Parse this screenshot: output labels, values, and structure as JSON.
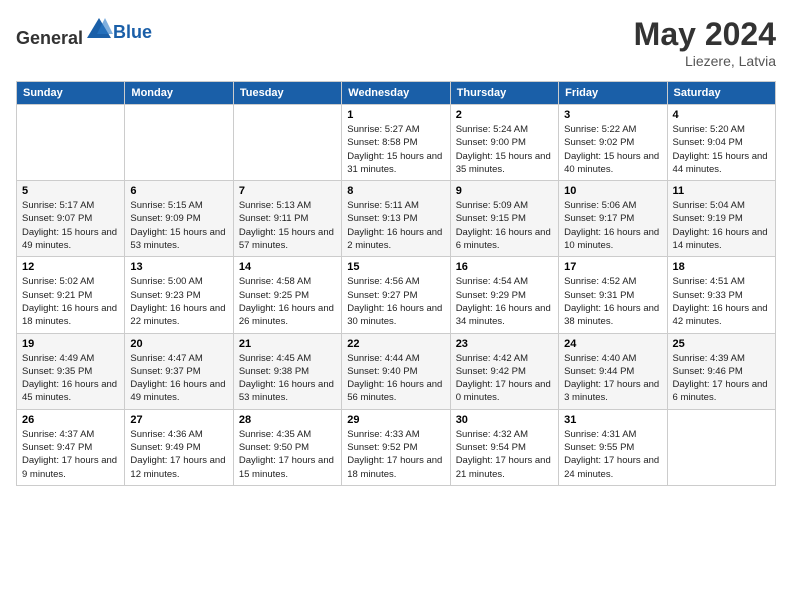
{
  "header": {
    "logo_general": "General",
    "logo_blue": "Blue",
    "month_year": "May 2024",
    "location": "Liezere, Latvia"
  },
  "days_of_week": [
    "Sunday",
    "Monday",
    "Tuesday",
    "Wednesday",
    "Thursday",
    "Friday",
    "Saturday"
  ],
  "weeks": [
    [
      {
        "day": "",
        "info": ""
      },
      {
        "day": "",
        "info": ""
      },
      {
        "day": "",
        "info": ""
      },
      {
        "day": "1",
        "info": "Sunrise: 5:27 AM\nSunset: 8:58 PM\nDaylight: 15 hours\nand 31 minutes."
      },
      {
        "day": "2",
        "info": "Sunrise: 5:24 AM\nSunset: 9:00 PM\nDaylight: 15 hours\nand 35 minutes."
      },
      {
        "day": "3",
        "info": "Sunrise: 5:22 AM\nSunset: 9:02 PM\nDaylight: 15 hours\nand 40 minutes."
      },
      {
        "day": "4",
        "info": "Sunrise: 5:20 AM\nSunset: 9:04 PM\nDaylight: 15 hours\nand 44 minutes."
      }
    ],
    [
      {
        "day": "5",
        "info": "Sunrise: 5:17 AM\nSunset: 9:07 PM\nDaylight: 15 hours\nand 49 minutes."
      },
      {
        "day": "6",
        "info": "Sunrise: 5:15 AM\nSunset: 9:09 PM\nDaylight: 15 hours\nand 53 minutes."
      },
      {
        "day": "7",
        "info": "Sunrise: 5:13 AM\nSunset: 9:11 PM\nDaylight: 15 hours\nand 57 minutes."
      },
      {
        "day": "8",
        "info": "Sunrise: 5:11 AM\nSunset: 9:13 PM\nDaylight: 16 hours\nand 2 minutes."
      },
      {
        "day": "9",
        "info": "Sunrise: 5:09 AM\nSunset: 9:15 PM\nDaylight: 16 hours\nand 6 minutes."
      },
      {
        "day": "10",
        "info": "Sunrise: 5:06 AM\nSunset: 9:17 PM\nDaylight: 16 hours\nand 10 minutes."
      },
      {
        "day": "11",
        "info": "Sunrise: 5:04 AM\nSunset: 9:19 PM\nDaylight: 16 hours\nand 14 minutes."
      }
    ],
    [
      {
        "day": "12",
        "info": "Sunrise: 5:02 AM\nSunset: 9:21 PM\nDaylight: 16 hours\nand 18 minutes."
      },
      {
        "day": "13",
        "info": "Sunrise: 5:00 AM\nSunset: 9:23 PM\nDaylight: 16 hours\nand 22 minutes."
      },
      {
        "day": "14",
        "info": "Sunrise: 4:58 AM\nSunset: 9:25 PM\nDaylight: 16 hours\nand 26 minutes."
      },
      {
        "day": "15",
        "info": "Sunrise: 4:56 AM\nSunset: 9:27 PM\nDaylight: 16 hours\nand 30 minutes."
      },
      {
        "day": "16",
        "info": "Sunrise: 4:54 AM\nSunset: 9:29 PM\nDaylight: 16 hours\nand 34 minutes."
      },
      {
        "day": "17",
        "info": "Sunrise: 4:52 AM\nSunset: 9:31 PM\nDaylight: 16 hours\nand 38 minutes."
      },
      {
        "day": "18",
        "info": "Sunrise: 4:51 AM\nSunset: 9:33 PM\nDaylight: 16 hours\nand 42 minutes."
      }
    ],
    [
      {
        "day": "19",
        "info": "Sunrise: 4:49 AM\nSunset: 9:35 PM\nDaylight: 16 hours\nand 45 minutes."
      },
      {
        "day": "20",
        "info": "Sunrise: 4:47 AM\nSunset: 9:37 PM\nDaylight: 16 hours\nand 49 minutes."
      },
      {
        "day": "21",
        "info": "Sunrise: 4:45 AM\nSunset: 9:38 PM\nDaylight: 16 hours\nand 53 minutes."
      },
      {
        "day": "22",
        "info": "Sunrise: 4:44 AM\nSunset: 9:40 PM\nDaylight: 16 hours\nand 56 minutes."
      },
      {
        "day": "23",
        "info": "Sunrise: 4:42 AM\nSunset: 9:42 PM\nDaylight: 17 hours\nand 0 minutes."
      },
      {
        "day": "24",
        "info": "Sunrise: 4:40 AM\nSunset: 9:44 PM\nDaylight: 17 hours\nand 3 minutes."
      },
      {
        "day": "25",
        "info": "Sunrise: 4:39 AM\nSunset: 9:46 PM\nDaylight: 17 hours\nand 6 minutes."
      }
    ],
    [
      {
        "day": "26",
        "info": "Sunrise: 4:37 AM\nSunset: 9:47 PM\nDaylight: 17 hours\nand 9 minutes."
      },
      {
        "day": "27",
        "info": "Sunrise: 4:36 AM\nSunset: 9:49 PM\nDaylight: 17 hours\nand 12 minutes."
      },
      {
        "day": "28",
        "info": "Sunrise: 4:35 AM\nSunset: 9:50 PM\nDaylight: 17 hours\nand 15 minutes."
      },
      {
        "day": "29",
        "info": "Sunrise: 4:33 AM\nSunset: 9:52 PM\nDaylight: 17 hours\nand 18 minutes."
      },
      {
        "day": "30",
        "info": "Sunrise: 4:32 AM\nSunset: 9:54 PM\nDaylight: 17 hours\nand 21 minutes."
      },
      {
        "day": "31",
        "info": "Sunrise: 4:31 AM\nSunset: 9:55 PM\nDaylight: 17 hours\nand 24 minutes."
      },
      {
        "day": "",
        "info": ""
      }
    ]
  ]
}
